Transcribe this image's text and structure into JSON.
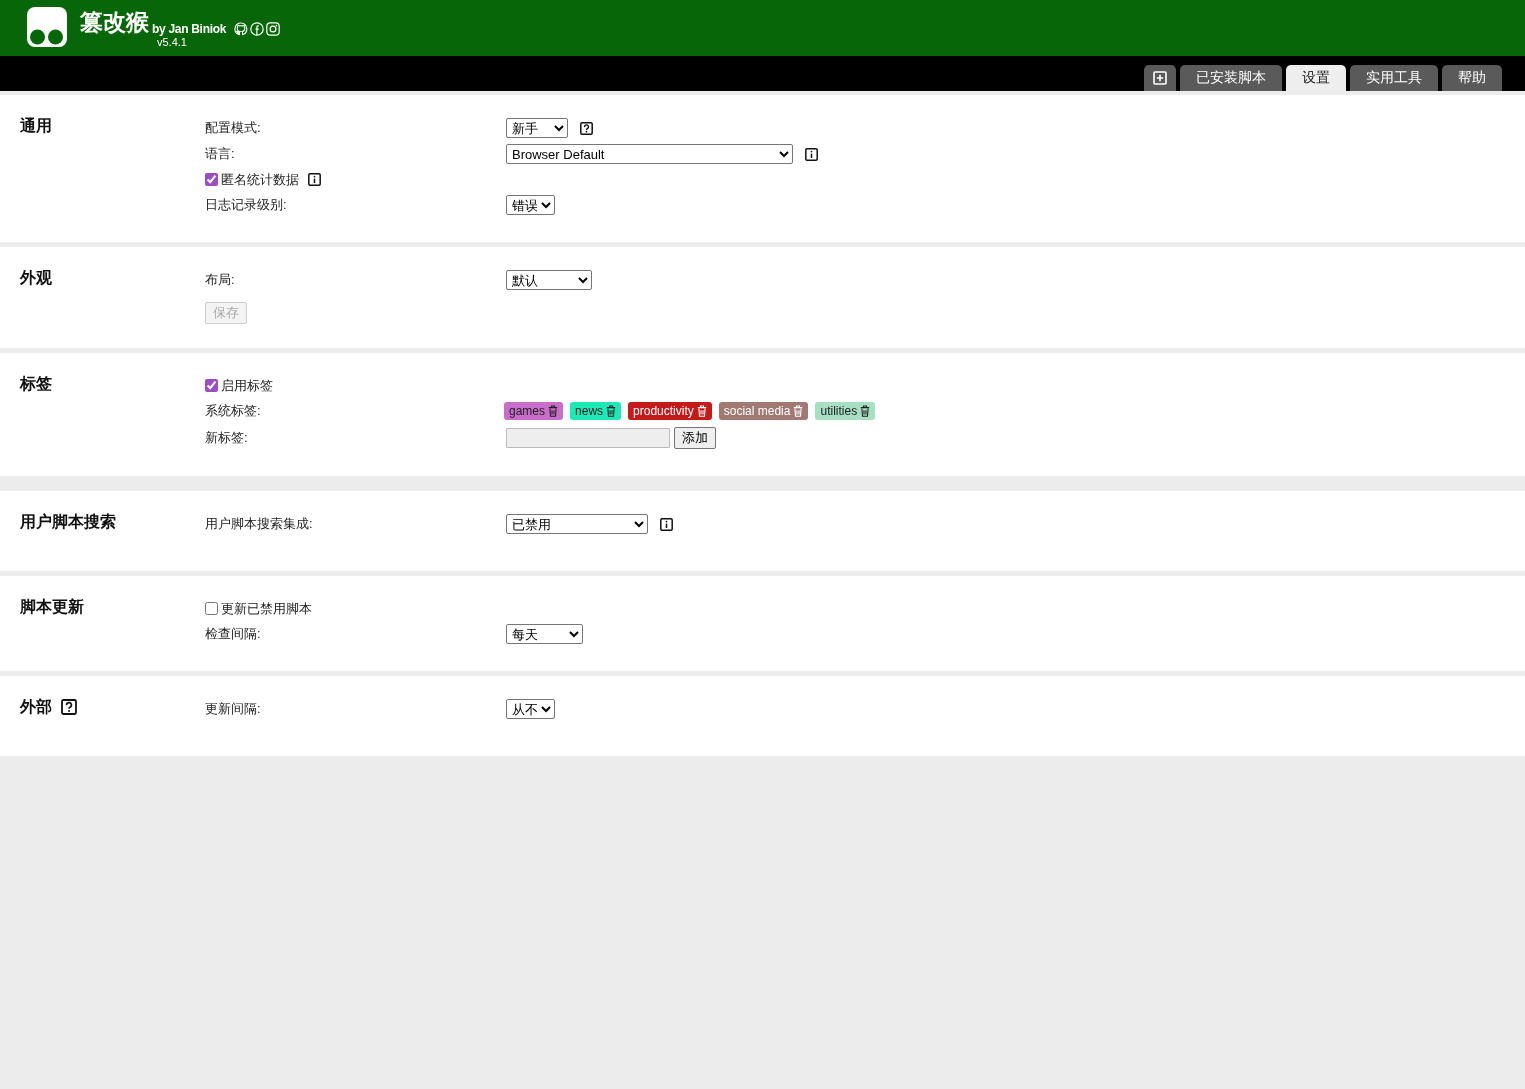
{
  "header": {
    "title": "篡改猴",
    "byline": "by Jan Biniok",
    "version": "v5.4.1"
  },
  "tabs": [
    {
      "kind": "icon",
      "selected": false
    },
    {
      "kind": "text",
      "label": "已安装脚本",
      "selected": false
    },
    {
      "kind": "text",
      "label": "设置",
      "selected": true
    },
    {
      "kind": "text",
      "label": "实用工具",
      "selected": false
    },
    {
      "kind": "text",
      "label": "帮助",
      "selected": false
    }
  ],
  "sections": [
    {
      "title": "通用",
      "rows": [
        {
          "kind": "select",
          "label": "配置模式:",
          "value": "新手"
        },
        {
          "kind": "select",
          "label": "语言:",
          "value": "Browser Default"
        },
        {
          "kind": "checkbox",
          "label": "匿名统计数据",
          "checked": true
        },
        {
          "kind": "select",
          "label": "日志记录级别:",
          "value": "错误"
        }
      ]
    },
    {
      "title": "外观",
      "rows": [
        {
          "kind": "select",
          "label": "布局:",
          "value": "默认"
        },
        {
          "kind": "button",
          "label": "保存",
          "disabled": true
        }
      ]
    },
    {
      "title": "标签",
      "rows": [
        {
          "kind": "checkbox",
          "label": "启用标签",
          "checked": true
        },
        {
          "kind": "tags",
          "label": "系统标签:",
          "tags": [
            {
              "label": "games",
              "color": "#c86dc9"
            },
            {
              "label": "news",
              "color": "#1de9b6"
            },
            {
              "label": "productivity",
              "color": "#c41a1a"
            },
            {
              "label": "social media",
              "color": "#a07a72"
            },
            {
              "label": "utilities",
              "color": "#a7dfc2"
            }
          ]
        },
        {
          "kind": "input",
          "label": "新标签:",
          "button": "添加"
        }
      ]
    },
    {
      "title": "用户脚本搜索",
      "rows": [
        {
          "kind": "select",
          "label": "用户脚本搜索集成:",
          "value": "已禁用"
        }
      ]
    },
    {
      "title": "脚本更新",
      "rows": [
        {
          "kind": "checkbox",
          "label": "更新已禁用脚本",
          "checked": false
        },
        {
          "kind": "select",
          "label": "检查间隔:",
          "value": "每天"
        }
      ]
    },
    {
      "title": "外部",
      "rows": [
        {
          "kind": "select",
          "label": "更新间隔:",
          "value": "从不"
        }
      ]
    }
  ]
}
